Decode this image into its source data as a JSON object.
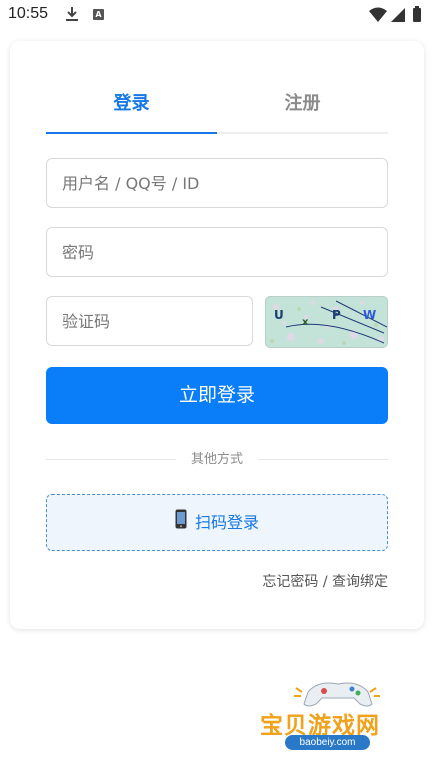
{
  "status_bar": {
    "time": "10:55",
    "download_icon": "download-icon",
    "a_badge": "A",
    "wifi_icon": "wifi-icon",
    "signal_icon": "signal-icon",
    "battery_icon": "battery-icon"
  },
  "tabs": [
    {
      "label": "登录",
      "active": true
    },
    {
      "label": "注册",
      "active": false
    }
  ],
  "form": {
    "username_placeholder": "用户名 / QQ号 / ID",
    "password_placeholder": "密码",
    "captcha_placeholder": "验证码",
    "captcha_text": "U x P W"
  },
  "login_button": "立即登录",
  "divider_text": "其他方式",
  "qr_login": {
    "icon": "phone-icon",
    "label": "扫码登录"
  },
  "forgot_link": "忘记密码 / 查询绑定",
  "watermark": {
    "title": "宝贝游戏网",
    "url": "baobeiy.com"
  },
  "colors": {
    "accent": "#1677e6",
    "button": "#0a7df8",
    "watermark": "#f0a21a"
  }
}
